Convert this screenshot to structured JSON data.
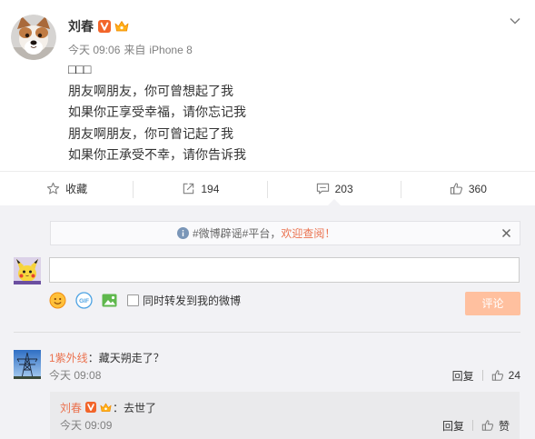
{
  "colors": {
    "link": "#eb7350",
    "text": "#333333",
    "muted": "#808080",
    "panel_bg": "#f2f2f5",
    "reply_bg": "#eaeaec",
    "submit_bg": "#ffc09f",
    "verified_badge": "#f2652a"
  },
  "post": {
    "author": "刘春",
    "author_badges": [
      "verified-v-icon",
      "member-crown-icon"
    ],
    "time": "今天 09:06",
    "via_label": "来自",
    "device": "iPhone 8",
    "menu_icon": "chevron-down-icon",
    "lines": [
      "□□□",
      "朋友啊朋友，你可曾想起了我",
      "如果你正享受幸福，请你忘记我",
      "朋友啊朋友，你可曾记起了我",
      "如果你正承受不幸，请你告诉我"
    ]
  },
  "actions": [
    {
      "icon": "star-icon",
      "label": "收藏"
    },
    {
      "icon": "share-icon",
      "label": "194"
    },
    {
      "icon": "comment-icon",
      "label": "203",
      "active": true
    },
    {
      "icon": "like-icon",
      "label": "360"
    }
  ],
  "notice": {
    "icon": "info-icon",
    "topic": "#微博辟谣#平台，",
    "cta": "欢迎查阅！",
    "close_icon": "close-icon"
  },
  "composer": {
    "value": "",
    "tools": {
      "emoji_icon": "smiley-icon",
      "gif_icon": "gif-icon",
      "gif_text": "GIF",
      "image_icon": "image-icon"
    },
    "repost_label": "同时转发到我的微博",
    "repost_checked": false,
    "submit_label": "评论",
    "submit_enabled": false
  },
  "comments": [
    {
      "author": "1紫外线",
      "text": "：藏天朔走了？",
      "time": "今天 09:08",
      "reply_label": "回复",
      "like_icon": "like-icon",
      "likes": "24",
      "replies": [
        {
          "author": "刘春",
          "author_badges": [
            "verified-v-icon",
            "member-crown-icon"
          ],
          "text": "：去世了",
          "time": "今天 09:09",
          "reply_label": "回复",
          "like_icon": "like-icon",
          "like_label": "赞"
        }
      ]
    }
  ]
}
